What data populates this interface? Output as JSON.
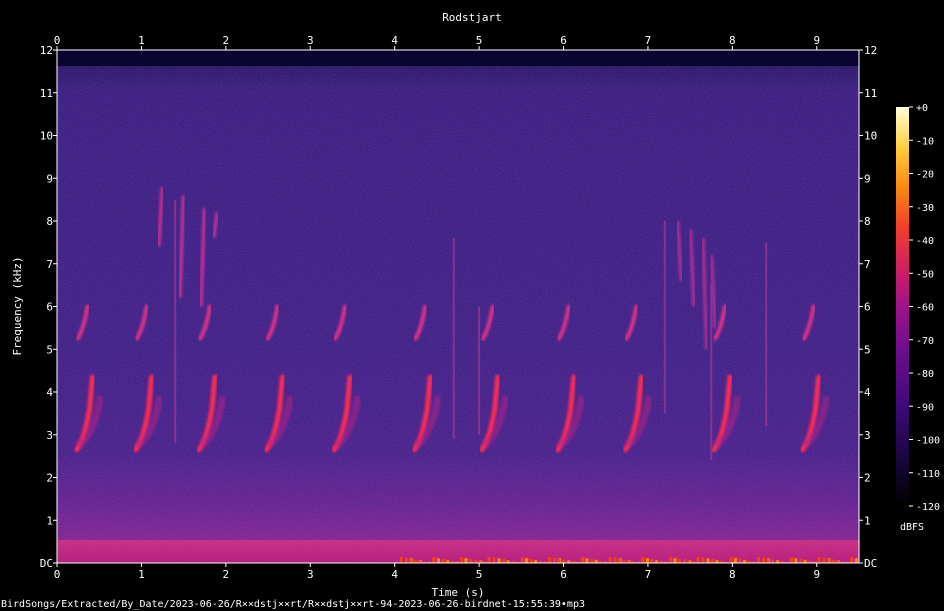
{
  "chart_data": {
    "type": "heatmap",
    "title": "Rodstjart",
    "xlabel": "Time (s)",
    "ylabel": "Frequency (kHz)",
    "xlim": [
      0,
      9.5
    ],
    "ylim": [
      0,
      12
    ],
    "x_ticks": [
      "0",
      "1",
      "2",
      "3",
      "4",
      "5",
      "6",
      "7",
      "8",
      "9"
    ],
    "y_ticks": [
      "DC",
      "1",
      "2",
      "3",
      "4",
      "5",
      "6",
      "7",
      "8",
      "9",
      "10",
      "11",
      "12"
    ],
    "colorbar": {
      "label": "dBFS",
      "range": [
        -120,
        0
      ],
      "ticks": [
        "+0",
        "-10",
        "-20",
        "-30",
        "-40",
        "-50",
        "-60",
        "-70",
        "-80",
        "-90",
        "-100",
        "-110",
        "-120"
      ],
      "colors": [
        "#000000",
        "#1a0640",
        "#3d0a7a",
        "#6a0d8c",
        "#a0128a",
        "#d42060",
        "#f0402a",
        "#fb8a10",
        "#fed040",
        "#ffffd8"
      ]
    },
    "file_path": "BirdSongs/Extracted/By_Date/2023-06-26/R××dstj××rt/R××dstj××rt-94-2023-06-26-birdnet-15:55:39•mp3",
    "song_phrases": [
      {
        "t": 0.35
      },
      {
        "t": 1.05
      },
      {
        "t": 1.8
      },
      {
        "t": 2.6
      },
      {
        "t": 3.4
      },
      {
        "t": 4.35
      },
      {
        "t": 5.15
      },
      {
        "t": 6.05
      },
      {
        "t": 6.85
      },
      {
        "t": 7.9
      },
      {
        "t": 8.95
      }
    ]
  }
}
